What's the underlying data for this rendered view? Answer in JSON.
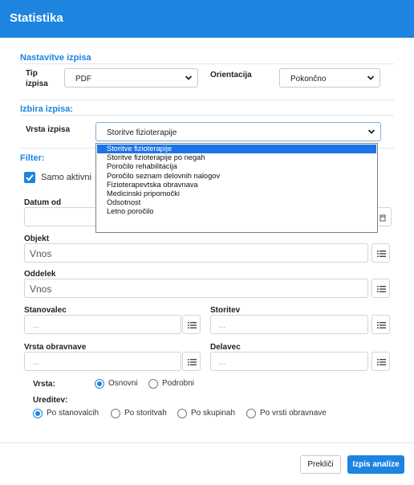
{
  "window": {
    "title": "Statistika"
  },
  "settings": {
    "section_title": "Nastavitve izpisa",
    "type_label_line1": "Tip",
    "type_label_line2": "izpisa",
    "type_value": "PDF",
    "orientation_label": "Orientacija",
    "orientation_value": "Pokončno"
  },
  "report": {
    "section_title": "Izbira izpisa:",
    "kind_label": "Vrsta izpisa",
    "kind_value": "Storitve fizioterapije",
    "options": [
      "Storitve fizioterapije",
      "Storitve fizioterapije po negah",
      "Poročilo rehabilitacija",
      "Poročilo seznam delovnih nalogov",
      "Fizioterapevtska obravnava",
      "Medicinski pripomočki",
      "Odsotnost",
      "Letno poročilo"
    ],
    "selected_index": 0
  },
  "filter": {
    "section_title": "Filter:",
    "only_active_label": "Samo aktivni",
    "date_from_label": "Datum od",
    "object_label": "Objekt",
    "object_placeholder": "Vnos",
    "department_label": "Oddelek",
    "department_placeholder": "Vnos",
    "resident_label": "Stanovalec",
    "resident_placeholder": "...",
    "service_label": "Storitev",
    "service_placeholder": "...",
    "treatment_type_label": "Vrsta obravnave",
    "treatment_type_placeholder": "...",
    "worker_label": "Delavec",
    "worker_placeholder": "...",
    "kind_label": "Vrsta:",
    "kind_options": [
      "Osnovni",
      "Podrobni"
    ],
    "kind_selected": "Osnovni",
    "sort_label": "Ureditev:",
    "sort_options": [
      "Po stanovalcih",
      "Po storitvah",
      "Po skupinah",
      "Po vrsti obravnave"
    ],
    "sort_selected": "Po stanovalcih"
  },
  "footer": {
    "cancel_label": "Prekliči",
    "submit_label": "Izpis analize"
  },
  "colors": {
    "accent": "#1d84e0",
    "dropdown_highlight": "#1e74e6"
  },
  "icons": {
    "chevron": "chevron-down-icon",
    "list": "list-icon",
    "check": "check-icon",
    "calendar": "calendar-icon"
  }
}
